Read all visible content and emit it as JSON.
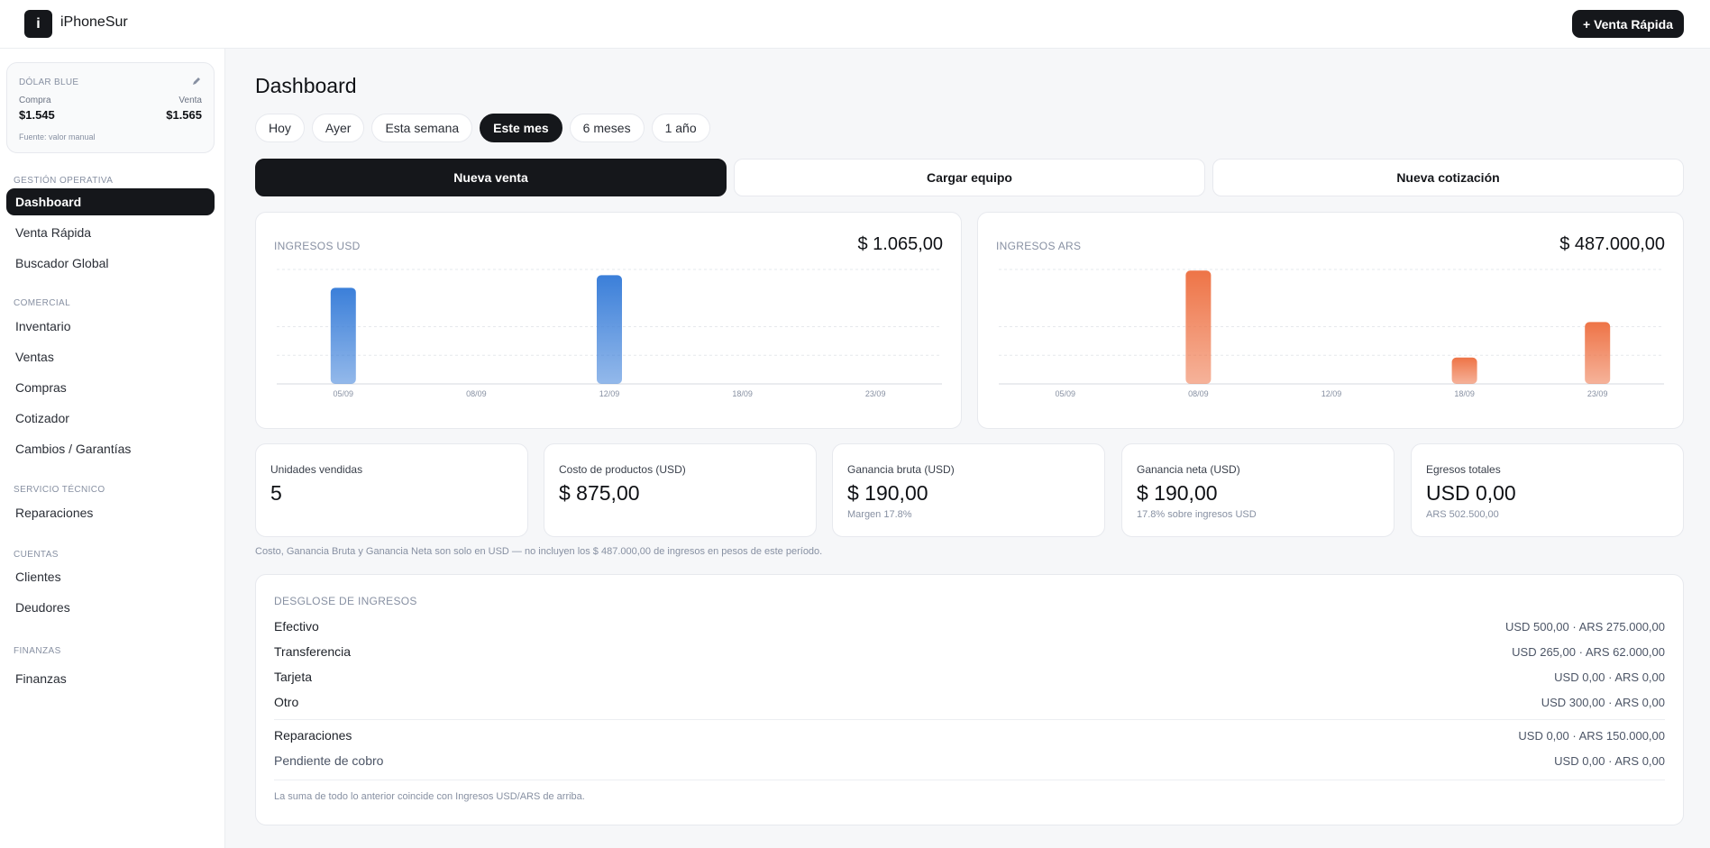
{
  "app": {
    "logo_letter": "i",
    "name": "iPhoneSur",
    "quick_sale": "+ Venta Rápida"
  },
  "dolar": {
    "title": "DÓLAR BLUE",
    "buy_label": "Compra",
    "sell_label": "Venta",
    "buy": "$1.545",
    "sell": "$1.565",
    "source": "Fuente: valor manual"
  },
  "sidebar": {
    "sections": [
      {
        "title": "GESTIÓN OPERATIVA"
      },
      {
        "title": "COMERCIAL"
      },
      {
        "title": "SERVICIO TÉCNICO"
      },
      {
        "title": "CUENTAS"
      },
      {
        "title": "FINANZAS"
      }
    ],
    "items": [
      {
        "label": "Dashboard"
      },
      {
        "label": "Venta Rápida"
      },
      {
        "label": "Buscador Global"
      },
      {
        "label": "Inventario"
      },
      {
        "label": "Ventas"
      },
      {
        "label": "Compras"
      },
      {
        "label": "Cotizador"
      },
      {
        "label": "Cambios / Garantías"
      },
      {
        "label": "Reparaciones"
      },
      {
        "label": "Clientes"
      },
      {
        "label": "Deudores"
      },
      {
        "label": "Finanzas"
      }
    ],
    "active": "Dashboard"
  },
  "page": {
    "title": "Dashboard"
  },
  "periods": {
    "items": [
      "Hoy",
      "Ayer",
      "Esta semana",
      "Este mes",
      "6 meses",
      "1 año"
    ],
    "active": "Este mes"
  },
  "actions": {
    "new_sale": "Nueva venta",
    "load_device": "Cargar equipo",
    "new_quote": "Nueva cotización"
  },
  "chart_data": [
    {
      "type": "bar",
      "title": "INGRESOS USD",
      "total": "$ 1.065,00",
      "color": "#3b7fd9",
      "x_ticks": [
        "05/09",
        "08/09",
        "12/09",
        "18/09",
        "23/09"
      ],
      "bars": [
        {
          "x": "05/09",
          "value": 0.84
        },
        {
          "x": "12/09",
          "value": 0.95
        }
      ],
      "ylim": [
        0,
        1
      ]
    },
    {
      "type": "bar",
      "title": "INGRESOS ARS",
      "total": "$ 487.000,00",
      "color": "#ee7447",
      "x_ticks": [
        "05/09",
        "08/09",
        "12/09",
        "18/09",
        "23/09"
      ],
      "bars": [
        {
          "x": "08/09",
          "value": 0.99
        },
        {
          "x": "18/09",
          "value": 0.23
        },
        {
          "x": "23/09",
          "value": 0.54
        }
      ],
      "ylim": [
        0,
        1
      ]
    }
  ],
  "kpis": [
    {
      "label": "Unidades vendidas",
      "value": "5",
      "sub": ""
    },
    {
      "label": "Costo de productos (USD)",
      "value": "$ 875,00",
      "sub": ""
    },
    {
      "label": "Ganancia bruta (USD)",
      "value": "$ 190,00",
      "sub": "Margen 17.8%"
    },
    {
      "label": "Ganancia neta (USD)",
      "value": "$ 190,00",
      "sub": "17.8% sobre ingresos USD"
    },
    {
      "label": "Egresos totales",
      "value": "USD 0,00",
      "sub": "ARS 502.500,00"
    }
  ],
  "disclaimer": "Costo, Ganancia Bruta y Ganancia Neta son solo en USD — no incluyen los $ 487.000,00 de ingresos en pesos de este período.",
  "breakdown": {
    "title": "DESGLOSE DE INGRESOS",
    "rows": [
      {
        "label": "Efectivo",
        "value": "USD 500,00 · ARS 275.000,00"
      },
      {
        "label": "Transferencia",
        "value": "USD 265,00 · ARS 62.000,00"
      },
      {
        "label": "Tarjeta",
        "value": "USD 0,00 · ARS 0,00"
      },
      {
        "label": "Otro",
        "value": "USD 300,00 · ARS 0,00"
      },
      {
        "label": "Reparaciones",
        "value": "USD 0,00 · ARS 150.000,00"
      },
      {
        "label": "Pendiente de cobro",
        "value": "USD 0,00 · ARS 0,00"
      }
    ],
    "footer": "La suma de todo lo anterior coincide con Ingresos USD/ARS de arriba."
  }
}
